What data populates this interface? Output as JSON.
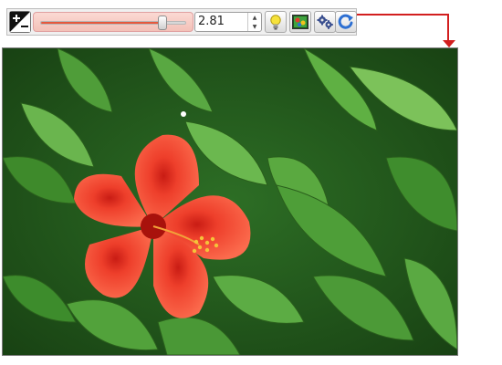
{
  "toolbar": {
    "exposure_icon": "exposure-plus-minus-icon",
    "slider": {
      "level": 0.83,
      "accent": "#e7583c"
    },
    "value": "2.81",
    "buttons": [
      {
        "name": "lightbulb-button",
        "icon": "lightbulb-icon"
      },
      {
        "name": "color-picture-button",
        "icon": "picture-icon"
      },
      {
        "name": "settings-button",
        "icon": "gears-icon"
      },
      {
        "name": "reset-button",
        "icon": "refresh-icon"
      }
    ]
  },
  "annotation": {
    "color": "#d21f1f",
    "icon": "arrow-down-icon"
  },
  "photo": {
    "subject": "red-hibiscus-flower",
    "colors": {
      "flower": "#f24b33",
      "leaves": "#3f8f2e"
    }
  }
}
